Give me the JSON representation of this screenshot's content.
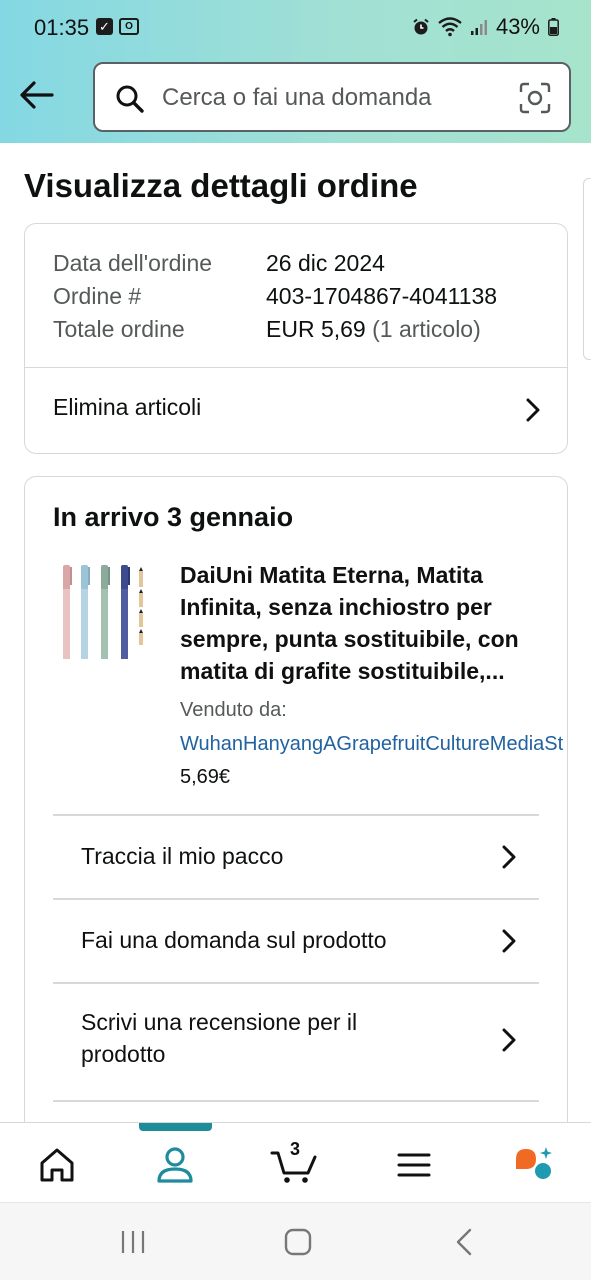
{
  "status_bar": {
    "time": "01:35",
    "battery": "43%"
  },
  "header": {
    "search_placeholder": "Cerca o fai una domanda"
  },
  "page": {
    "title": "Visualizza dettagli ordine"
  },
  "order_summary": {
    "rows": [
      {
        "label": "Data dell'ordine",
        "value": "26 dic 2024"
      },
      {
        "label": "Ordine #",
        "value": "403-1704867-4041138"
      },
      {
        "label": "Totale ordine",
        "value": "EUR 5,69",
        "extra": "(1 articolo)"
      }
    ],
    "delete_items_label": "Elimina articoli"
  },
  "shipment": {
    "arrival": "In arrivo 3 gennaio",
    "product_title": "DaiUni Matita Eterna, Matita Infinita, senza inchiostro per sempre, punta sostituibile, con matita di grafite sostituibile,...",
    "sold_by_label": "Venduto da:",
    "seller": "WuhanHanyangAGrapefruitCultureMediaSt",
    "price": "5,69€",
    "actions": [
      {
        "label": "Traccia il mio pacco"
      },
      {
        "label": "Fai una domanda sul prodotto"
      },
      {
        "label": "Scrivi una recensione per il prodotto"
      }
    ]
  },
  "bottom_nav": {
    "cart_count": "3",
    "items": [
      "home-icon",
      "account-icon",
      "cart-icon",
      "menu-icon",
      "rufus-ai-icon"
    ],
    "active": "account-icon",
    "accent": "#1e8c9a"
  },
  "colors": {
    "header_gradient_start": "#84d8e3",
    "header_gradient_end": "#a6e4cc",
    "link": "#2162a1",
    "text_primary": "#0f1111",
    "text_secondary": "#565959"
  }
}
